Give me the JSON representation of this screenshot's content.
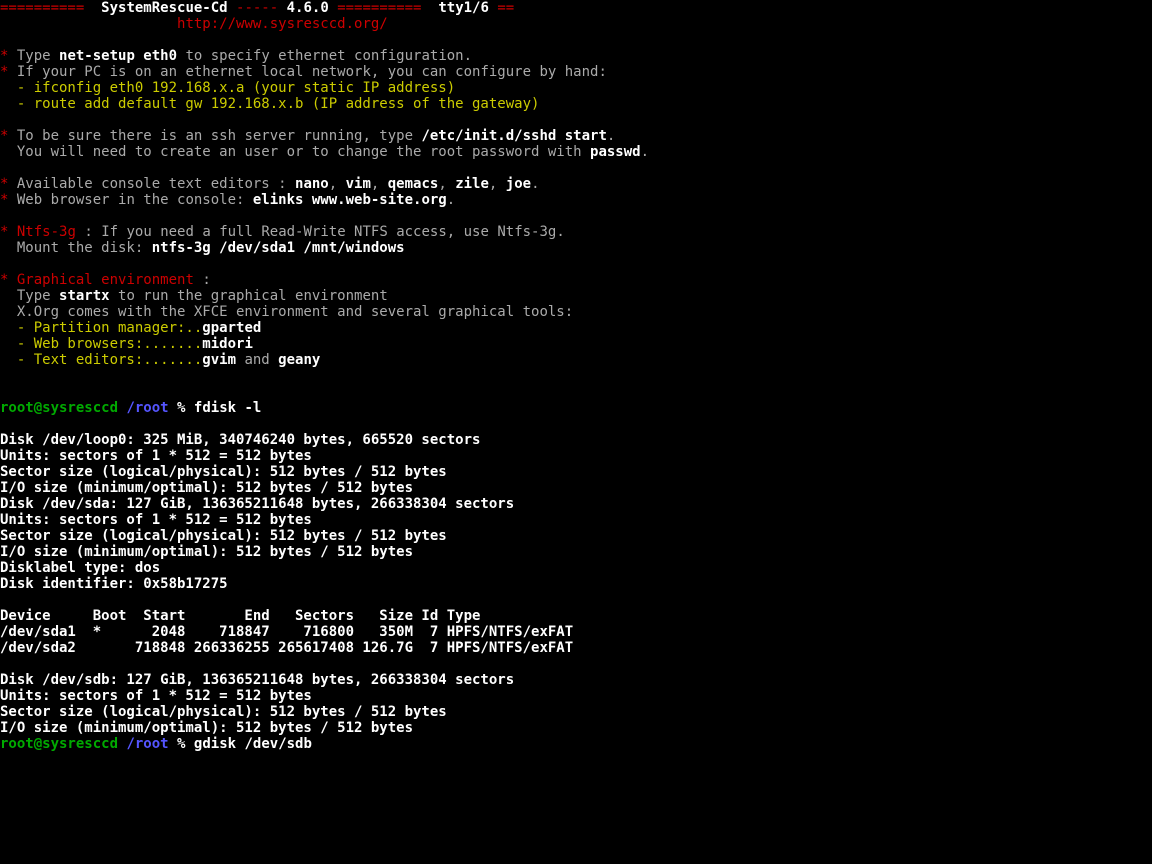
{
  "header": {
    "eq_left": "==========  ",
    "title1": "SystemRescue-Cd",
    "dash": " ----- ",
    "version": "4.6.0",
    "eq_mid": " ==========  ",
    "tty": "tty1/6",
    "eq_end": " ==",
    "url_indent": "                     ",
    "url": "http://www.sysresccd.org/"
  },
  "b_net": {
    "pre": " Type ",
    "cmd": "net-setup eth0",
    "post": " to specify ethernet configuration."
  },
  "b_hand": " If your PC is on an ethernet local network, you can configure by hand:",
  "ifconfig": "  - ifconfig eth0 192.168.x.a (your static IP address)",
  "route": "  - route add default gw 192.168.x.b (IP address of the gateway)",
  "b_ssh": {
    "pre": " To be sure there is an ssh server running, type ",
    "cmd": "/etc/init.d/sshd start",
    "post": "."
  },
  "ssh2": {
    "pre": "  You will need to create an user or to change the root password with ",
    "cmd": "passwd",
    "post": "."
  },
  "b_editors": {
    "pre": " Available console text editors : ",
    "e1": "nano",
    "c1": ", ",
    "e2": "vim",
    "c2": ", ",
    "e3": "qemacs",
    "c3": ", ",
    "e4": "zile",
    "c4": ", ",
    "e5": "joe",
    "c5": "."
  },
  "b_web": {
    "pre": " Web browser in the console: ",
    "cmd": "elinks www.web-site.org",
    "post": "."
  },
  "b_ntfs": {
    "label": "Ntfs-3g",
    "sep": " : ",
    "post": "If you need a full Read-Write NTFS access, use Ntfs-3g."
  },
  "ntfs_mount": {
    "pre": "  Mount the disk: ",
    "cmd": "ntfs-3g /dev/sda1 /mnt/windows"
  },
  "b_graph": {
    "label": "Graphical environment",
    "sep": " :"
  },
  "graph_startx": {
    "pre": "  Type ",
    "cmd": "startx",
    "post": " to run the graphical environment"
  },
  "graph_xorg": "  X.Org comes with the XFCE environment and several graphical tools:",
  "tool_part": {
    "pre": "  - Partition manager:..",
    "cmd": "gparted"
  },
  "tool_web": {
    "pre": "  - Web browsers:.......",
    "cmd": "midori"
  },
  "tool_txt": {
    "pre": "  - Text editors:.......",
    "cmd1": "gvim",
    "mid": " and ",
    "cmd2": "geany"
  },
  "prompt1": {
    "user": "root@sysresccd",
    "sp": " ",
    "cwd": "/root",
    "pct": " % ",
    "cmd": "fdisk -l"
  },
  "fdisk_out": [
    "Disk /dev/loop0: 325 MiB, 340746240 bytes, 665520 sectors",
    "Units: sectors of 1 * 512 = 512 bytes",
    "Sector size (logical/physical): 512 bytes / 512 bytes",
    "I/O size (minimum/optimal): 512 bytes / 512 bytes",
    "Disk /dev/sda: 127 GiB, 136365211648 bytes, 266338304 sectors",
    "Units: sectors of 1 * 512 = 512 bytes",
    "Sector size (logical/physical): 512 bytes / 512 bytes",
    "I/O size (minimum/optimal): 512 bytes / 512 bytes",
    "Disklabel type: dos",
    "Disk identifier: 0x58b17275"
  ],
  "table_header": "Device     Boot  Start       End   Sectors   Size Id Type",
  "table_row1": "/dev/sda1  *      2048    718847    716800   350M  7 HPFS/NTFS/exFAT",
  "table_row2": "/dev/sda2       718848 266336255 265617408 126.7G  7 HPFS/NTFS/exFAT",
  "sdb_out": [
    "Disk /dev/sdb: 127 GiB, 136365211648 bytes, 266338304 sectors",
    "Units: sectors of 1 * 512 = 512 bytes",
    "Sector size (logical/physical): 512 bytes / 512 bytes",
    "I/O size (minimum/optimal): 512 bytes / 512 bytes"
  ],
  "prompt2": {
    "user": "root@sysresccd",
    "sp": " ",
    "cwd": "/root",
    "pct": " % ",
    "cmd": "gdisk /dev/sdb"
  }
}
